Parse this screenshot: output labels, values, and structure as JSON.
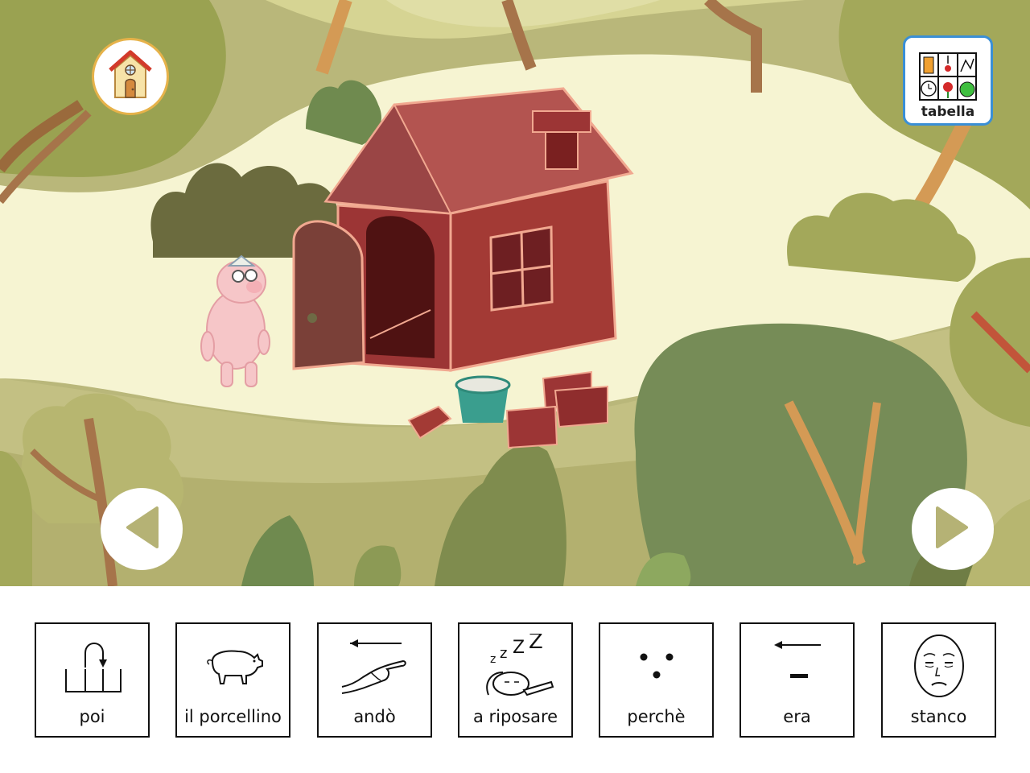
{
  "header": {
    "home_icon": "house-icon",
    "table_button": {
      "label": "tabella",
      "icon": "symbol-grid-icon"
    }
  },
  "navigation": {
    "prev_icon": "triangle-left-icon",
    "next_icon": "triangle-right-icon"
  },
  "sentence": {
    "cards": [
      {
        "word": "poi",
        "icon": "then-symbol-icon"
      },
      {
        "word": "il porcellino",
        "icon": "pig-icon"
      },
      {
        "word": "andò",
        "icon": "pointing-hand-icon"
      },
      {
        "word": "a riposare",
        "icon": "sleeping-icon"
      },
      {
        "word": "perchè",
        "icon": "because-dots-icon"
      },
      {
        "word": "era",
        "icon": "past-was-icon"
      },
      {
        "word": "stanco",
        "icon": "tired-face-icon"
      }
    ]
  },
  "colors": {
    "home_border": "#e6b24a",
    "table_border": "#3a8fd6",
    "nav_arrow": "#b5b275",
    "meadow": "#f6f4d2"
  }
}
